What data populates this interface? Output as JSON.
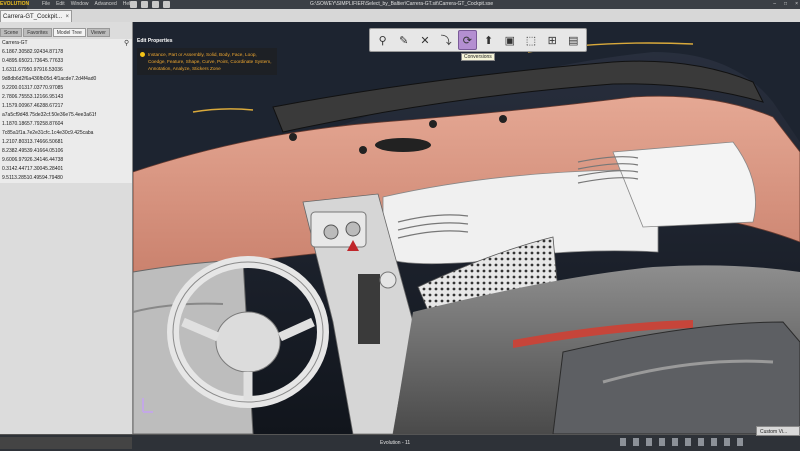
{
  "app": {
    "logo": "EVOLUTION",
    "menu": [
      "File",
      "Edit",
      "Window",
      "Advanced",
      "Help"
    ],
    "title": "G:\\SOWEY\\SIMPLIFIER\\Select_by_Baltier\\Carrera-GT.sit\\Carrera-GT_Cockpit.sse"
  },
  "file_tab": {
    "label": "Carrera-GT_Cockpit...",
    "close": "×"
  },
  "panel": {
    "tabs": [
      "Scene",
      "Favorites",
      "Model Tree",
      "Viewer"
    ],
    "active_tab": "Model Tree",
    "tree_rows": [
      "Carrera-GT",
      "6.1867.30582.92434.87178",
      "0.4895.65021.73645.77633",
      "1.6311.67950.97916.53036",
      "9d8db6d2f6a436fb05d.4f1acde7.2d4f4ad0",
      "9.2200.01317.03770.97085",
      "2.7806.75553.12166.95143",
      "1.1579.00967.46288.67217",
      "a7a5cf9d48.75de32cf.50e36e75.4ee3a61f",
      "1.1870.18657.79258.87604",
      "7c85a1f1a.7e2e31cfc.1c4e30c9.425caba",
      "1.2107.80313.74666.50681",
      "8.2382.49539.41664.05106",
      "9.6006.97926.34146.44738",
      "0.3142.44717.30045.28401",
      "9.5113.28510.49594.79480"
    ]
  },
  "edit_properties": {
    "title": "Edit Properties",
    "text": "Instance, Part or Assembly, Solid, Body, Face, Loop, Coedge, Feature, Shape, Curve, Point, Coordinate System, Annotation, Analyze, Stickers Zone"
  },
  "toolbar": {
    "tooltip": "Conversions",
    "buttons": [
      "search",
      "edit",
      "tools",
      "move",
      "convert",
      "upload",
      "frame",
      "select-bounds",
      "tree",
      "export"
    ]
  },
  "status": {
    "center": "Evolution - 11",
    "custom_view": "Custom Vi..."
  },
  "colors": {
    "accent_tool": "#b48fd1",
    "salmon_trim": "#d99a86",
    "edit_text": "#f0a830"
  }
}
